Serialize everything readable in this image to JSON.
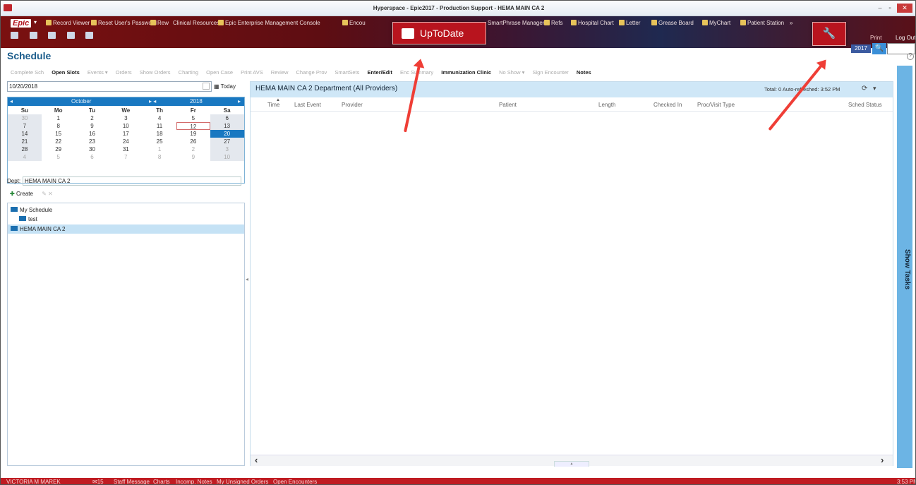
{
  "window": {
    "title": "Hyperspace - Epic2017 - Production Support - HEMA MAIN CA 2",
    "minimize": "–",
    "restore": "▫",
    "close": "✕"
  },
  "toolbar": {
    "logo": "Epic",
    "logo_caret": "▾",
    "items": [
      "Record Viewer",
      "Reset User's Password",
      "Rew",
      "Clinical Resources",
      "Epic Enterprise Management Console",
      "Encou",
      "SmartPhrase Manager",
      "Refs",
      "Hospital Chart",
      "Letter",
      "Grease Board",
      "MyChart",
      "Patient Station",
      "»"
    ],
    "print": "Print",
    "logout": "Log Out",
    "version": "2017",
    "search_icon": "🔍"
  },
  "uptodate": {
    "label": "UpToDate",
    "icon": "uptodate-icon"
  },
  "wrench": {
    "icon": "wrench-icon",
    "glyph": "🔧"
  },
  "schedule": {
    "title": "Schedule",
    "help": "?",
    "actions": [
      {
        "label": "Complete Sch",
        "on": false
      },
      {
        "label": "Open Slots",
        "on": true
      },
      {
        "label": "Events ▾",
        "on": false
      },
      {
        "label": "Orders",
        "on": false
      },
      {
        "label": "Show Orders",
        "on": false
      },
      {
        "label": "Charting",
        "on": false
      },
      {
        "label": "Open Case",
        "on": false
      },
      {
        "label": "Print AVS",
        "on": false
      },
      {
        "label": "Review",
        "on": false
      },
      {
        "label": "Change Prov",
        "on": false
      },
      {
        "label": "SmartSets",
        "on": false
      },
      {
        "label": "Enter/Edit",
        "on": true
      },
      {
        "label": "Enc Summary",
        "on": false
      },
      {
        "label": "Immunization Clinic",
        "on": true
      },
      {
        "label": "No Show ▾",
        "on": false
      },
      {
        "label": "Sign Encounter",
        "on": false
      },
      {
        "label": "Notes",
        "on": true
      }
    ]
  },
  "left": {
    "date": "10/20/2018",
    "today": "Today",
    "calendar": {
      "month": "October",
      "year": "2018",
      "prev": "◂",
      "nav": "▸ ◂",
      "next": "▸",
      "days": [
        "Su",
        "Mo",
        "Tu",
        "We",
        "Th",
        "Fr",
        "Sa"
      ],
      "weeks": [
        [
          "30",
          "1",
          "2",
          "3",
          "4",
          "5",
          "6"
        ],
        [
          "7",
          "8",
          "9",
          "10",
          "11",
          "12",
          "13"
        ],
        [
          "14",
          "15",
          "16",
          "17",
          "18",
          "19",
          "20"
        ],
        [
          "21",
          "22",
          "23",
          "24",
          "25",
          "26",
          "27"
        ],
        [
          "28",
          "29",
          "30",
          "31",
          "1",
          "2",
          "3"
        ],
        [
          "4",
          "5",
          "6",
          "7",
          "8",
          "9",
          "10"
        ]
      ]
    },
    "dept_label": "Dept:",
    "dept_value": "HEMA MAIN CA 2",
    "create": "Create",
    "tree": [
      {
        "label": "My Schedule",
        "level": 0
      },
      {
        "label": "test",
        "level": 1
      },
      {
        "label": "HEMA MAIN CA 2",
        "level": 0,
        "selected": true
      }
    ]
  },
  "main": {
    "title": "HEMA MAIN CA 2 Department (All Providers)",
    "refresh_text": "Total: 0   Auto-refreshed: 3:52 PM",
    "columns": [
      "Time",
      "Last Event",
      "Provider",
      "Patient",
      "Length",
      "Checked In",
      "Proc/Visit Type",
      "Sched Status"
    ]
  },
  "side_tab": {
    "label": "Show Tasks"
  },
  "status": {
    "user": "VICTORIA M MAREK",
    "count": "15",
    "links": [
      "Staff Message",
      "Charts",
      "Incomp. Notes",
      "My Unsigned Orders",
      "Open Encounters"
    ],
    "time": "3:53 PM"
  }
}
